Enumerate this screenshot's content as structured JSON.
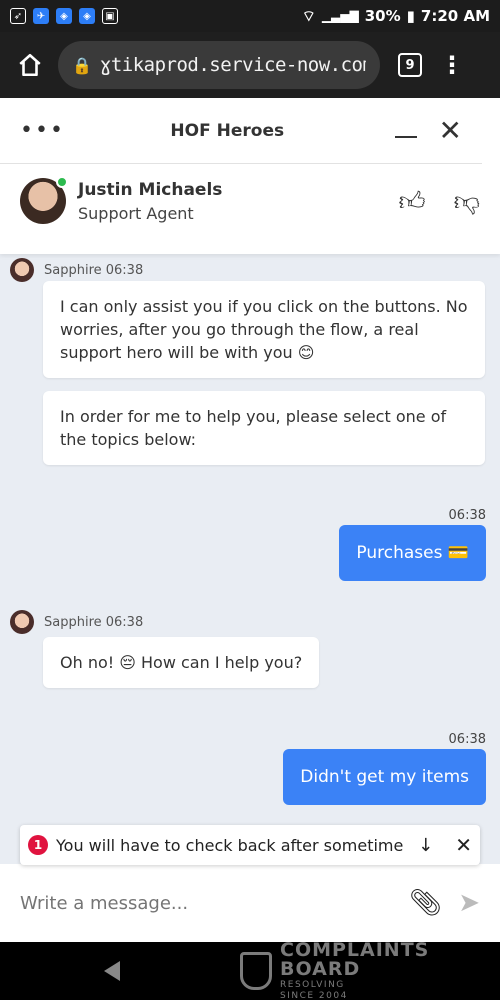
{
  "status_bar": {
    "icons": [
      "rocket-icon",
      "app-icon",
      "shield-icon",
      "shield-icon",
      "image-icon"
    ],
    "battery": "30%",
    "time": "7:20 AM"
  },
  "browser": {
    "url": "ɣtikaprod.service-now.com",
    "tab_count": "9"
  },
  "chat": {
    "title": "HOF Heroes",
    "agent": {
      "name": "Justin Michaels",
      "role": "Support Agent"
    },
    "messages": [
      {
        "sender": "Sapphire 06:38",
        "text": "I can only assist you if you click on the buttons. No worries, after you go through the flow, a real support hero will be with you 😊"
      },
      {
        "text": "In order for me to help you, please select one of the topics below:"
      },
      {
        "time": "06:38",
        "user_text": "Purchases 💳"
      },
      {
        "sender": "Sapphire 06:38",
        "text": "Oh no! 😔 How can I help you?"
      },
      {
        "time": "06:38",
        "user_text": "Didn't get my items"
      }
    ],
    "toast": {
      "count": "1",
      "text": "You will have to check back after sometime"
    },
    "composer_placeholder": "Write a message..."
  },
  "watermark": {
    "line1": "COMPLAINTS",
    "line2": "BOARD",
    "tag1": "RESOLVING",
    "tag2": "SINCE 2004"
  },
  "colors": {
    "user_bubble": "#3b82f6",
    "online": "#2dbb4f",
    "toast_badge": "#e0133f"
  }
}
